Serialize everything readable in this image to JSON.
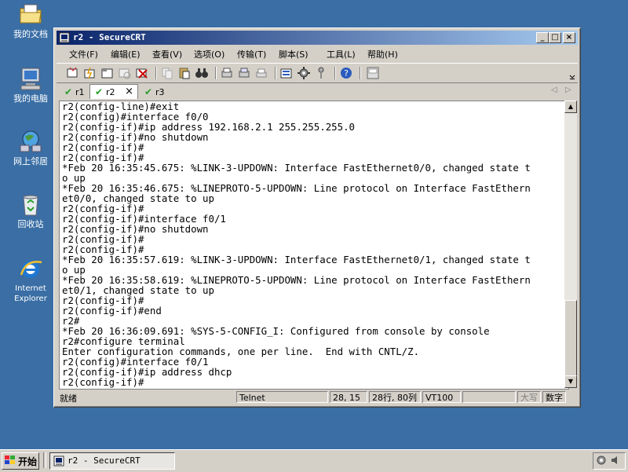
{
  "desktop": {
    "icons": [
      {
        "label": "我的文档",
        "icon": "my-documents-icon"
      },
      {
        "label": "我的电脑",
        "icon": "my-computer-icon"
      },
      {
        "label": "网上邻居",
        "icon": "network-icon"
      },
      {
        "label": "回收站",
        "icon": "recycle-bin-icon"
      },
      {
        "label": "Internet Explorer",
        "icon": "ie-icon"
      }
    ]
  },
  "window": {
    "title": "r2 - SecureCRT",
    "menu": [
      "文件(F)",
      "编辑(E)",
      "查看(V)",
      "选项(O)",
      "传输(T)",
      "脚本(S)",
      "工具(L)",
      "帮助(H)"
    ],
    "tabs": [
      {
        "label": "r1",
        "active": false
      },
      {
        "label": "r2",
        "active": true
      },
      {
        "label": "r3",
        "active": false
      }
    ],
    "terminal_lines": [
      "r2(config-line)#exit",
      "r2(config)#interface f0/0",
      "r2(config-if)#ip address 192.168.2.1 255.255.255.0",
      "r2(config-if)#no shutdown",
      "r2(config-if)#",
      "r2(config-if)#",
      "*Feb 20 16:35:45.675: %LINK-3-UPDOWN: Interface FastEthernet0/0, changed state t",
      "o up",
      "*Feb 20 16:35:46.675: %LINEPROTO-5-UPDOWN: Line protocol on Interface FastEthern",
      "et0/0, changed state to up",
      "r2(config-if)#",
      "r2(config-if)#interface f0/1",
      "r2(config-if)#no shutdown",
      "r2(config-if)#",
      "r2(config-if)#",
      "*Feb 20 16:35:57.619: %LINK-3-UPDOWN: Interface FastEthernet0/1, changed state t",
      "o up",
      "*Feb 20 16:35:58.619: %LINEPROTO-5-UPDOWN: Line protocol on Interface FastEthern",
      "et0/1, changed state to up",
      "r2(config-if)#",
      "r2(config-if)#end",
      "r2#",
      "*Feb 20 16:36:09.691: %SYS-5-CONFIG_I: Configured from console by console",
      "r2#configure terminal",
      "Enter configuration commands, one per line.  End with CNTL/Z.",
      "r2(config)#interface f0/1",
      "r2(config-if)#ip address dhcp",
      "r2(config-if)#"
    ],
    "status": {
      "ready": "就绪",
      "protocol": "Telnet",
      "cursor": "28, 15",
      "size": "28行, 80列",
      "emulation": "VT100",
      "caps": "大写",
      "num": "数字"
    }
  },
  "taskbar": {
    "start_label": "开始",
    "task_label": "r2 - SecureCRT"
  },
  "colors": {
    "desktop": "#3a6ea5",
    "title_start": "#0a246a",
    "title_end": "#a6caf0",
    "chrome": "#d4d0c8"
  }
}
